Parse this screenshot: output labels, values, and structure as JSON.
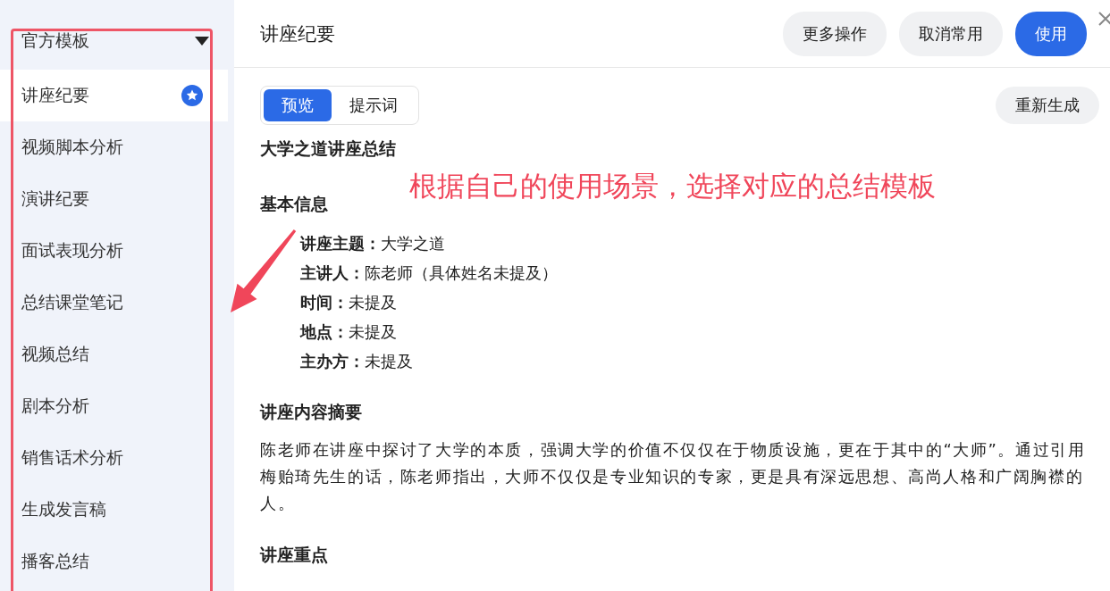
{
  "sidebar": {
    "group": {
      "label": "官方模板",
      "expanded": true
    },
    "items": [
      {
        "label": "讲座纪要",
        "selected": true,
        "favorite": true
      },
      {
        "label": "视频脚本分析",
        "selected": false,
        "favorite": false
      },
      {
        "label": "演讲纪要",
        "selected": false,
        "favorite": false
      },
      {
        "label": "面试表现分析",
        "selected": false,
        "favorite": false
      },
      {
        "label": "总结课堂笔记",
        "selected": false,
        "favorite": false
      },
      {
        "label": "视频总结",
        "selected": false,
        "favorite": false
      },
      {
        "label": "剧本分析",
        "selected": false,
        "favorite": false
      },
      {
        "label": "销售话术分析",
        "selected": false,
        "favorite": false
      },
      {
        "label": "生成发言稿",
        "selected": false,
        "favorite": false
      },
      {
        "label": "播客总结",
        "selected": false,
        "favorite": false
      }
    ]
  },
  "header": {
    "title": "讲座纪要",
    "buttons": [
      {
        "label": "更多操作",
        "kind": "secondary"
      },
      {
        "label": "取消常用",
        "kind": "secondary"
      },
      {
        "label": "使用",
        "kind": "primary"
      }
    ]
  },
  "tabs": [
    {
      "label": "预览",
      "selected": true
    },
    {
      "label": "提示词",
      "selected": false
    }
  ],
  "regenerate_button": "重新生成",
  "document": {
    "title": "大学之道讲座总结",
    "sections": [
      {
        "heading": "基本信息",
        "fields": [
          {
            "label": "讲座主题：",
            "value": "大学之道"
          },
          {
            "label": "主讲人：",
            "value": "陈老师（具体姓名未提及）"
          },
          {
            "label": "时间：",
            "value": "未提及"
          },
          {
            "label": "地点：",
            "value": "未提及"
          },
          {
            "label": "主办方：",
            "value": "未提及"
          }
        ]
      },
      {
        "heading": "讲座内容摘要",
        "paragraph": "陈老师在讲座中探讨了大学的本质，强调大学的价值不仅仅在于物质设施，更在于其中的“大师”。通过引用梅贻琦先生的话，陈老师指出，大师不仅仅是专业知识的专家，更是具有深远思想、高尚人格和广阔胸襟的人。"
      },
      {
        "heading": "讲座重点"
      }
    ]
  },
  "annotation": {
    "text": "根据自己的使用场景，选择对应的总结模板"
  }
}
